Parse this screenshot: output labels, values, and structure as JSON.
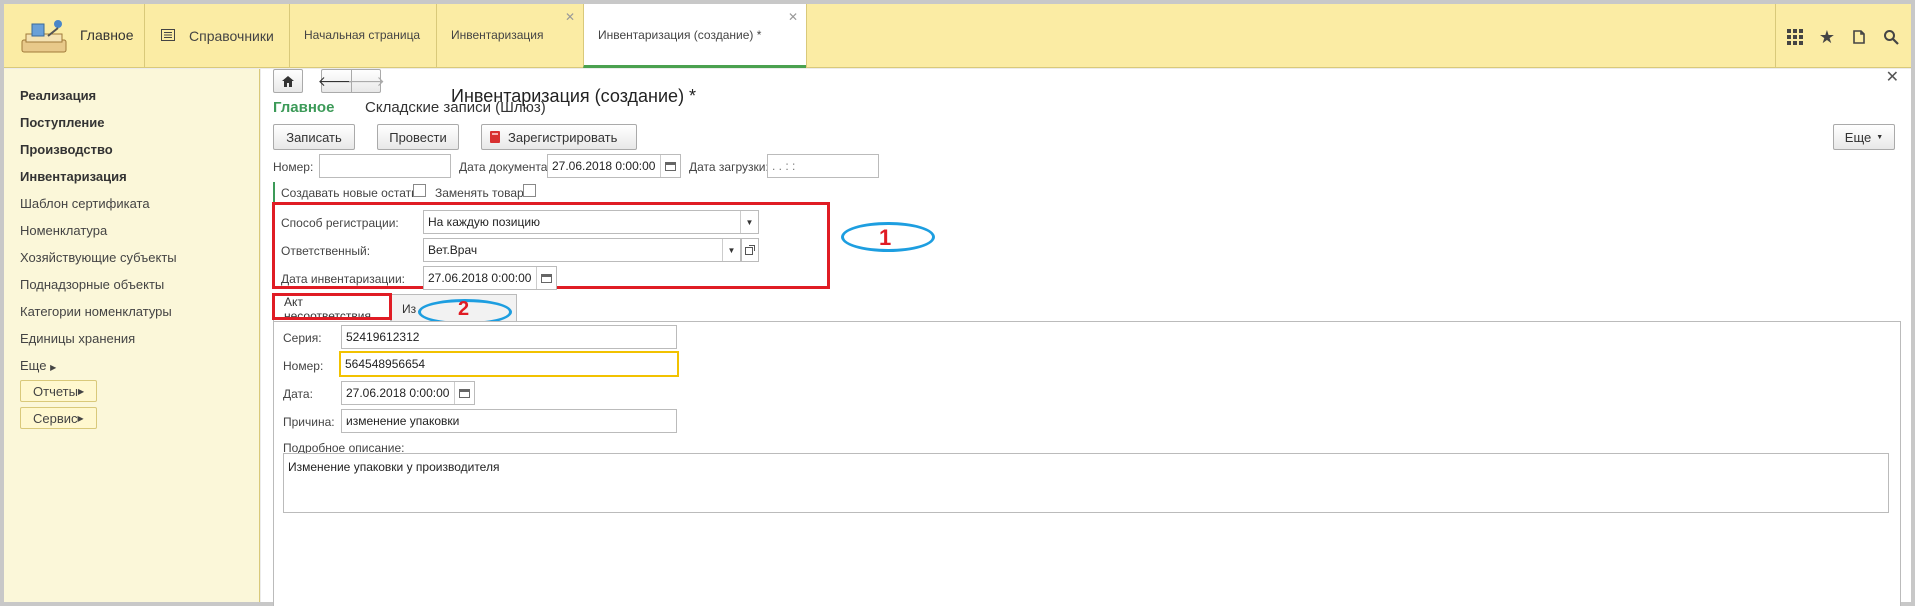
{
  "topbar": {
    "main_label": "Главное",
    "references_label": "Справочники",
    "tabs": [
      {
        "label": "Начальная страница",
        "closable": false
      },
      {
        "label": "Инвентаризация",
        "closable": true
      },
      {
        "label": "Инвентаризация (создание) *",
        "closable": true,
        "active": true
      }
    ],
    "icons": [
      "apps-grid-icon",
      "star-icon",
      "history-icon",
      "search-icon"
    ]
  },
  "sidebar": {
    "sections": [
      "Реализация",
      "Поступление",
      "Производство",
      "Инвентаризация"
    ],
    "items": [
      "Шаблон сертификата",
      "Номенклатура",
      "Хозяйствующие субъекты",
      "Поднадзорные объекты",
      "Категории номенклатуры",
      "Единицы хранения"
    ],
    "more_label": "Еще",
    "reports_label": "Отчеты",
    "service_label": "Сервис"
  },
  "form": {
    "title": "Инвентаризация (создание) *",
    "sections": {
      "main": "Главное",
      "other": "Складские записи (Шлюз)"
    },
    "buttons": {
      "save": "Записать",
      "post": "Провести",
      "register": "Зарегистрировать",
      "more": "Еще"
    },
    "number_label": "Номер:",
    "number_value": "",
    "doc_date_label": "Дата документа:",
    "doc_date_value": "27.06.2018  0:00:00",
    "load_date_label": "Дата загрузки:",
    "load_date_value": "  .  .       :  :",
    "create_new_label": "Создавать новые остатки:",
    "replace_label": "Заменять товар:",
    "reg_method_label": "Способ регистрации:",
    "reg_method_value": "На каждую позицию",
    "responsible_label": "Ответственный:",
    "responsible_value": "Вет.Врач",
    "inv_date_label": "Дата инвентаризации:",
    "inv_date_value": "27.06.2018  0:00:00",
    "annotation_1": "1",
    "annotation_2": "2",
    "tabs": {
      "act": "Акт несоответствия",
      "second": "Из"
    },
    "series_label": "Серия:",
    "series_value": "52419612312",
    "act_number_label": "Номер:",
    "act_number_value": "564548956654",
    "act_date_label": "Дата:",
    "act_date_value": "27.06.2018  0:00:00",
    "reason_label": "Причина:",
    "reason_value": "изменение упаковки",
    "description_label": "Подробное описание:",
    "description_value": "Изменение упаковки у производителя"
  },
  "colors": {
    "topbar_bg": "#fbeca4",
    "sidebar_bg": "#fbf7d9",
    "accent_green": "#3c9a58",
    "annotation_red": "#e01c24",
    "annotation_blue": "#1d9ee0",
    "focus_yellow": "#f2c200"
  }
}
